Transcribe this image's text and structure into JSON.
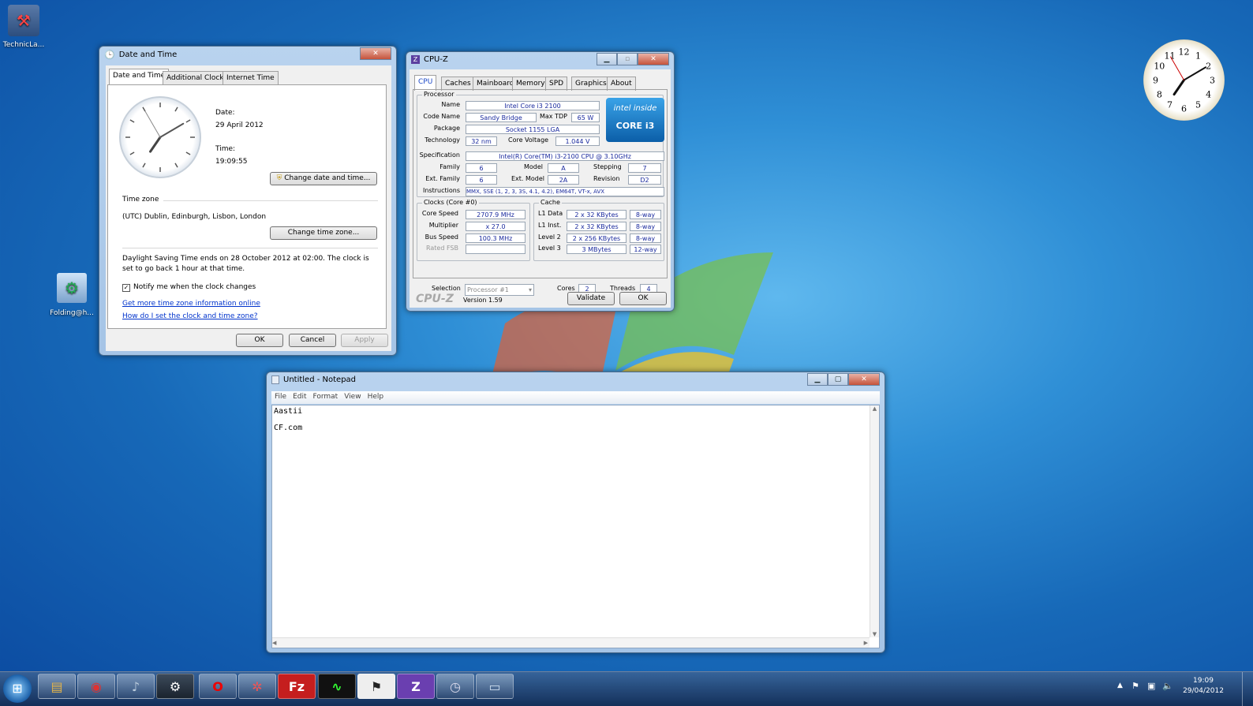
{
  "desktop": {
    "icons": [
      {
        "label": "TechnicLa..."
      },
      {
        "label": "Folding@h..."
      }
    ]
  },
  "datetime": {
    "title": "Date and Time",
    "tabs": [
      "Date and Time",
      "Additional Clocks",
      "Internet Time"
    ],
    "date_label": "Date:",
    "date_value": "29 April 2012",
    "time_label": "Time:",
    "time_value": "19:09:55",
    "change_dt": "Change date and time...",
    "tz_heading": "Time zone",
    "tz_value": "(UTC) Dublin, Edinburgh, Lisbon, London",
    "change_tz": "Change time zone...",
    "dst_text": "Daylight Saving Time ends on 28 October 2012 at 02:00. The clock is set to go back 1 hour at that time.",
    "notify": "Notify me when the clock changes",
    "link1": "Get more time zone information online",
    "link2": "How do I set the clock and time zone?",
    "ok": "OK",
    "cancel": "Cancel",
    "apply": "Apply"
  },
  "cpuz": {
    "title": "CPU-Z",
    "tabs": [
      "CPU",
      "Caches",
      "Mainboard",
      "Memory",
      "SPD",
      "Graphics",
      "About"
    ],
    "processor": "Processor",
    "name_l": "Name",
    "name_v": "Intel Core i3 2100",
    "code_l": "Code Name",
    "code_v": "Sandy Bridge",
    "tdp_l": "Max TDP",
    "tdp_v": "65 W",
    "pkg_l": "Package",
    "pkg_v": "Socket 1155 LGA",
    "tech_l": "Technology",
    "tech_v": "32 nm",
    "volt_l": "Core Voltage",
    "volt_v": "1.044 V",
    "spec_l": "Specification",
    "spec_v": "Intel(R) Core(TM) i3-2100 CPU @ 3.10GHz",
    "fam_l": "Family",
    "fam_v": "6",
    "model_l": "Model",
    "model_v": "A",
    "step_l": "Stepping",
    "step_v": "7",
    "efam_l": "Ext. Family",
    "efam_v": "6",
    "emod_l": "Ext. Model",
    "emod_v": "2A",
    "rev_l": "Revision",
    "rev_v": "D2",
    "instr_l": "Instructions",
    "instr_v": "MMX, SSE (1, 2, 3, 3S, 4.1, 4.2), EM64T, VT-x, AVX",
    "intel_inside": "intel inside",
    "core_i3": "CORE i3",
    "clocks": "Clocks (Core #0)",
    "cs_l": "Core Speed",
    "cs_v": "2707.9 MHz",
    "mul_l": "Multiplier",
    "mul_v": "x 27.0",
    "bus_l": "Bus Speed",
    "bus_v": "100.3 MHz",
    "fsb_l": "Rated FSB",
    "fsb_v": "",
    "cache": "Cache",
    "l1d_l": "L1 Data",
    "l1d_v": "2 x 32 KBytes",
    "l1d_w": "8-way",
    "l1i_l": "L1 Inst.",
    "l1i_v": "2 x 32 KBytes",
    "l1i_w": "8-way",
    "l2_l": "Level 2",
    "l2_v": "2 x 256 KBytes",
    "l2_w": "8-way",
    "l3_l": "Level 3",
    "l3_v": "3 MBytes",
    "l3_w": "12-way",
    "sel_l": "Selection",
    "sel_v": "Processor #1",
    "cores_l": "Cores",
    "cores_v": "2",
    "threads_l": "Threads",
    "threads_v": "4",
    "brand": "CPU-Z",
    "version": "Version 1.59",
    "validate": "Validate",
    "ok": "OK"
  },
  "notepad": {
    "title": "Untitled - Notepad",
    "menu": [
      "File",
      "Edit",
      "Format",
      "View",
      "Help"
    ],
    "line1": "Aastii",
    "line2": "CF.com"
  },
  "gadget_clock": {
    "numbers": [
      "12",
      "1",
      "2",
      "3",
      "4",
      "5",
      "6",
      "7",
      "8",
      "9",
      "10",
      "11"
    ]
  },
  "taskbar": {
    "time": "19:09",
    "date": "29/04/2012"
  },
  "colors": {
    "taskbar": "#1f3c66",
    "link": "#0033cc",
    "field_text": "#1a2a9e"
  }
}
